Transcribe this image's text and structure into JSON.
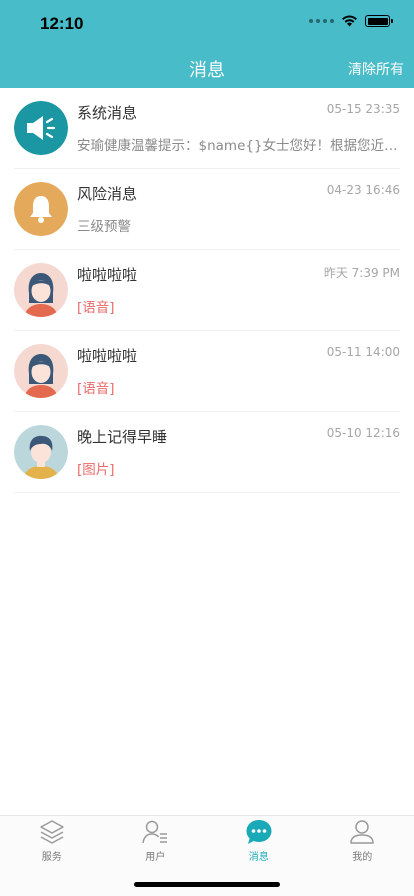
{
  "status_bar": {
    "time": "12:10"
  },
  "nav": {
    "title": "消息",
    "action_label": "清除所有"
  },
  "messages": [
    {
      "title": "系统消息",
      "time": "05-15 23:35",
      "preview": "安瑜健康温馨提示：$name{}女士您好！根据您近期的健康数据",
      "icon": "speaker-icon",
      "color": "#1a97a3"
    },
    {
      "title": "风险消息",
      "time": "04-23 16:46",
      "preview": "三级预警",
      "icon": "bell-icon",
      "color": "#e4a95a"
    },
    {
      "title": "啦啦啦啦",
      "time": "昨天 7:39 PM",
      "preview": "[语音]",
      "icon": "female-avatar",
      "color": "#f5d8cf"
    },
    {
      "title": "啦啦啦啦",
      "time": "05-11 14:00",
      "preview": "[语音]",
      "icon": "female-avatar",
      "color": "#f5d8cf"
    },
    {
      "title": "晚上记得早睡",
      "time": "05-10 12:16",
      "preview": "[图片]",
      "icon": "male-avatar",
      "color": "#bcd7dc"
    }
  ],
  "tabs": [
    {
      "label": "服务",
      "icon": "layers-icon",
      "active": false
    },
    {
      "label": "用户",
      "icon": "user-list-icon",
      "active": false
    },
    {
      "label": "消息",
      "icon": "chat-bubble-icon",
      "active": true
    },
    {
      "label": "我的",
      "icon": "person-icon",
      "active": false
    }
  ],
  "colors": {
    "header": "#48bcc8",
    "tab_active": "#1aa9b6",
    "tag_text": "#e86a6a"
  }
}
